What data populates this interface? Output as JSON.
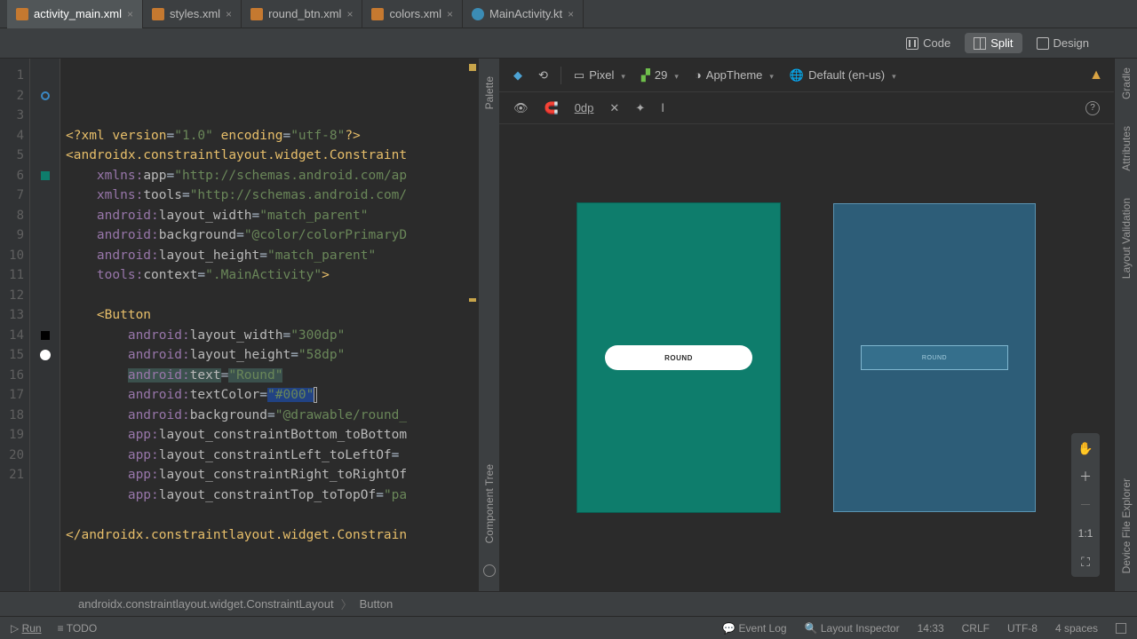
{
  "tabs": [
    {
      "label": "activity_main.xml",
      "icon": "xml",
      "active": true
    },
    {
      "label": "styles.xml",
      "icon": "xml"
    },
    {
      "label": "round_btn.xml",
      "icon": "xml"
    },
    {
      "label": "colors.xml",
      "icon": "xml"
    },
    {
      "label": "MainActivity.kt",
      "icon": "kt"
    }
  ],
  "view_modes": {
    "code": "Code",
    "split": "Split",
    "design": "Design",
    "active": "Split"
  },
  "preview_toolbar": {
    "device": "Pixel",
    "api": "29",
    "theme": "AppTheme",
    "locale": "Default (en-us)"
  },
  "preview_toolbar2": {
    "margin": "0dp"
  },
  "preview": {
    "button_text": "ROUND"
  },
  "zoom": {
    "ratio": "1:1"
  },
  "side_labels": {
    "palette": "Palette",
    "component_tree": "Component Tree",
    "attributes": "Attributes",
    "gradle": "Gradle",
    "layout_validation": "Layout Validation",
    "device_file_explorer": "Device File Explorer"
  },
  "breadcrumb": {
    "a": "androidx.constraintlayout.widget.ConstraintLayout",
    "b": "Button"
  },
  "status": {
    "run": "Run",
    "todo": "TODO",
    "event_log": "Event Log",
    "layout_inspector": "Layout Inspector",
    "time": "14:33",
    "eol": "CRLF",
    "enc": "UTF-8",
    "indent": "4 spaces"
  },
  "code": {
    "lines": [
      "1",
      "2",
      "3",
      "4",
      "5",
      "6",
      "7",
      "8",
      "9",
      "10",
      "11",
      "12",
      "13",
      "14",
      "15",
      "16",
      "17",
      "18",
      "19",
      "20",
      "21"
    ],
    "l1": {
      "a": "<?",
      "b": "xml version",
      "c": "=",
      "d": "\"1.0\"",
      "e": " encoding",
      "f": "=",
      "g": "\"utf-8\"",
      "h": "?>"
    },
    "l2": {
      "a": "<",
      "b": "androidx.constraintlayout.widget.Constraint"
    },
    "l3": {
      "ns": "xmlns:",
      "k": "app",
      "eq": "=",
      "v": "\"http://schemas.android.com/ap"
    },
    "l4": {
      "ns": "xmlns:",
      "k": "tools",
      "eq": "=",
      "v": "\"http://schemas.android.com/"
    },
    "l5": {
      "ns": "android:",
      "k": "layout_width",
      "eq": "=",
      "v": "\"match_parent\""
    },
    "l6": {
      "ns": "android:",
      "k": "background",
      "eq": "=",
      "v": "\"@color/colorPrimaryD"
    },
    "l7": {
      "ns": "android:",
      "k": "layout_height",
      "eq": "=",
      "v": "\"match_parent\""
    },
    "l8": {
      "ns": "tools:",
      "k": "context",
      "eq": "=",
      "v": "\".MainActivity\"",
      "end": ">"
    },
    "l10": {
      "a": "<",
      "b": "Button"
    },
    "l11": {
      "ns": "android:",
      "k": "layout_width",
      "eq": "=",
      "v": "\"300dp\""
    },
    "l12": {
      "ns": "android:",
      "k": "layout_height",
      "eq": "=",
      "v": "\"58dp\""
    },
    "l13": {
      "ns": "android:",
      "k": "text",
      "eq": "=",
      "v": "\"Round\""
    },
    "l14": {
      "ns": "android:",
      "k": "textColor",
      "eq": "=",
      "v": "\"#000\""
    },
    "l15": {
      "ns": "android:",
      "k": "background",
      "eq": "=",
      "v": "\"@drawable/round_"
    },
    "l16": {
      "ns": "app:",
      "k": "layout_constraintBottom_toBottom"
    },
    "l17": {
      "ns": "app:",
      "k": "layout_constraintLeft_toLeftOf",
      "eq": "="
    },
    "l18": {
      "ns": "app:",
      "k": "layout_constraintRight_toRightOf"
    },
    "l19": {
      "ns": "app:",
      "k": "layout_constraintTop_toTopOf",
      "eq": "=",
      "v": "\"pa"
    },
    "l21": {
      "a": "</",
      "b": "androidx.constraintlayout.widget.Constrain"
    }
  }
}
